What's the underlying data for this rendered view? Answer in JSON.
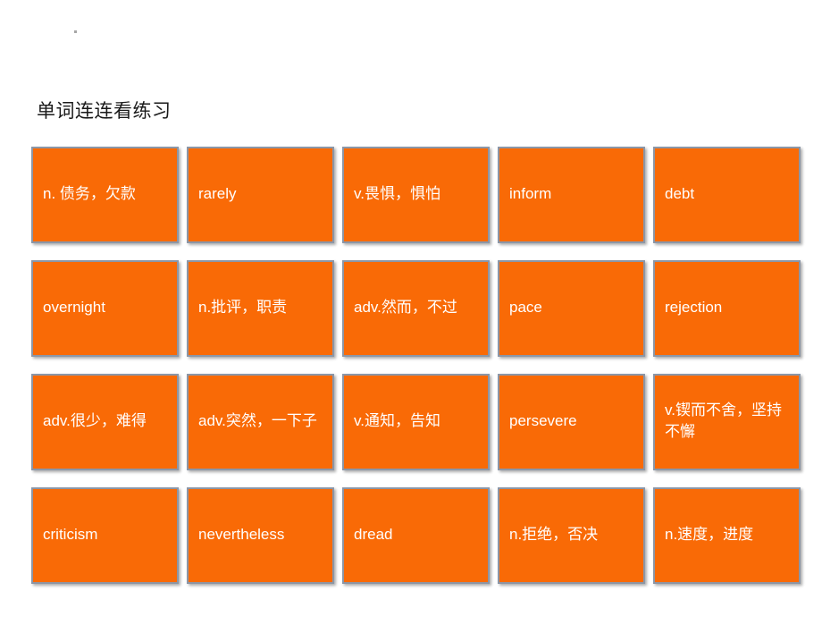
{
  "slide": {
    "title": "单词连连看练习",
    "bullet_marker": "bullet-dot",
    "background_color": "#ffffff",
    "card_color": "#f96a06",
    "card_border_color": "#8c96a6",
    "card_text_color": "#ffffff",
    "title_color": "#1a1a1a"
  },
  "grid": {
    "columns": 5,
    "rows": 4,
    "cards": [
      {
        "text": "n. 债务，欠款",
        "row": 1,
        "col": 1
      },
      {
        "text": "rarely",
        "row": 1,
        "col": 2
      },
      {
        "text": "v.畏惧，惧怕",
        "row": 1,
        "col": 3
      },
      {
        "text": "inform",
        "row": 1,
        "col": 4
      },
      {
        "text": "debt",
        "row": 1,
        "col": 5
      },
      {
        "text": "overnight",
        "row": 2,
        "col": 1
      },
      {
        "text": "n.批评，职责",
        "row": 2,
        "col": 2
      },
      {
        "text": "adv.然而，不过",
        "row": 2,
        "col": 3
      },
      {
        "text": "pace",
        "row": 2,
        "col": 4
      },
      {
        "text": "rejection",
        "row": 2,
        "col": 5
      },
      {
        "text": "adv.很少，难得",
        "row": 3,
        "col": 1
      },
      {
        "text": "adv.突然，一下子",
        "row": 3,
        "col": 2
      },
      {
        "text": "v.通知，告知",
        "row": 3,
        "col": 3
      },
      {
        "text": "persevere",
        "row": 3,
        "col": 4
      },
      {
        "text": "v.锲而不舍，坚持不懈",
        "row": 3,
        "col": 5
      },
      {
        "text": "criticism",
        "row": 4,
        "col": 1
      },
      {
        "text": "nevertheless",
        "row": 4,
        "col": 2
      },
      {
        "text": "dread",
        "row": 4,
        "col": 3
      },
      {
        "text": "n.拒绝，否决",
        "row": 4,
        "col": 4
      },
      {
        "text": "n.速度，进度",
        "row": 4,
        "col": 5
      }
    ]
  }
}
